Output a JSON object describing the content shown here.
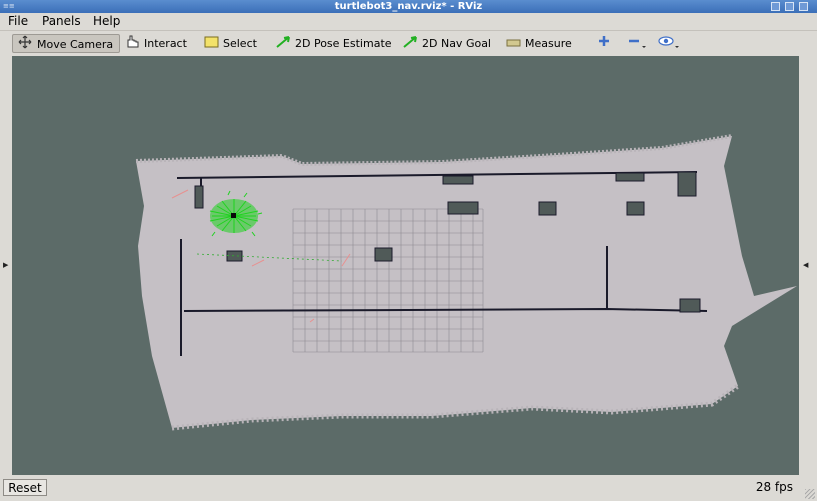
{
  "window": {
    "title": "turtlebot3_nav.rviz* - RViz"
  },
  "menu": [
    "File",
    "Panels",
    "Help"
  ],
  "toolbar": {
    "move_camera": "Move Camera",
    "interact": "Interact",
    "select": "Select",
    "pose_estimate": "2D Pose Estimate",
    "nav_goal": "2D Nav Goal",
    "measure": "Measure"
  },
  "status": {
    "reset": "Reset",
    "fps": "28 fps"
  },
  "colors": {
    "background": "#5c6b68",
    "map_free": "#c3bec3",
    "particles": "#1fd21f",
    "walls": "#1a1a2a"
  }
}
